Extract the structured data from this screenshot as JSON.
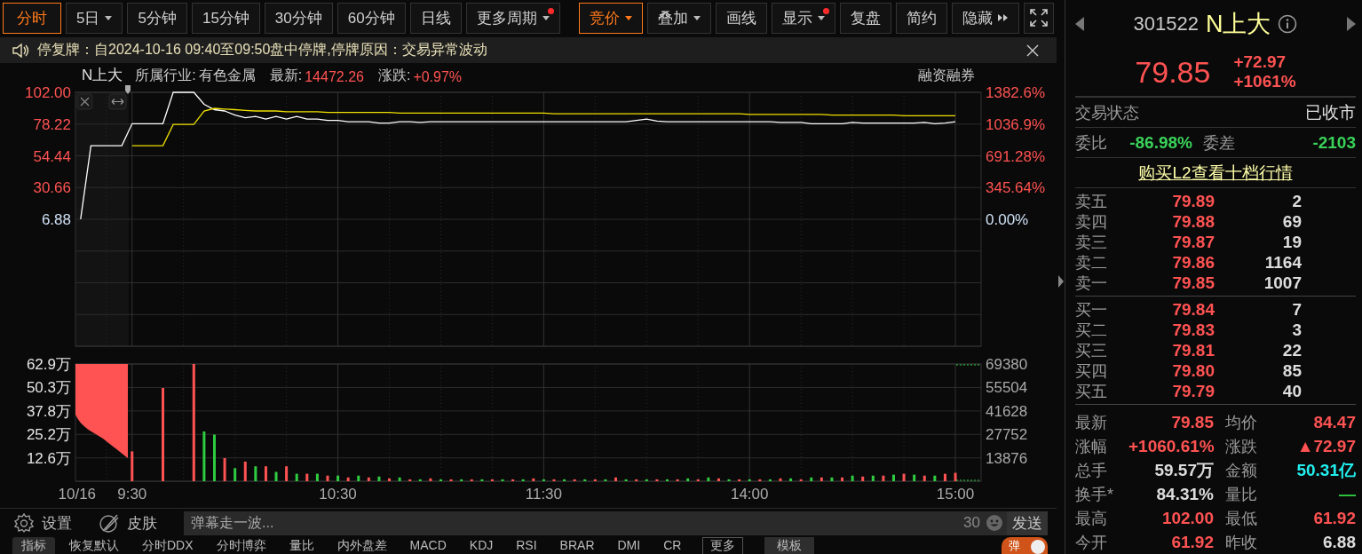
{
  "toolbar": {
    "periods": [
      {
        "label": "分时",
        "selected": true,
        "dropdown": false,
        "dot": false
      },
      {
        "label": "5日",
        "selected": false,
        "dropdown": true,
        "dot": false
      },
      {
        "label": "5分钟",
        "selected": false,
        "dropdown": false,
        "dot": false
      },
      {
        "label": "15分钟",
        "selected": false,
        "dropdown": false,
        "dot": false
      },
      {
        "label": "30分钟",
        "selected": false,
        "dropdown": false,
        "dot": false
      },
      {
        "label": "60分钟",
        "selected": false,
        "dropdown": false,
        "dot": false
      },
      {
        "label": "日线",
        "selected": false,
        "dropdown": false,
        "dot": false
      },
      {
        "label": "更多周期",
        "selected": false,
        "dropdown": true,
        "dot": true
      }
    ],
    "tools": [
      {
        "label": "竞价",
        "on": true,
        "dropdown": true,
        "dot": false
      },
      {
        "label": "叠加",
        "on": false,
        "dropdown": true,
        "dot": false
      },
      {
        "label": "画线",
        "on": false,
        "dropdown": false,
        "dot": false
      },
      {
        "label": "显示",
        "on": false,
        "dropdown": true,
        "dot": true
      },
      {
        "label": "复盘",
        "on": false,
        "dropdown": false,
        "dot": false
      },
      {
        "label": "简约",
        "on": false,
        "dropdown": false,
        "dot": false
      }
    ],
    "hide_button": "隐藏"
  },
  "notice": "停复牌：自2024-10-16 09:40至09:50盘中停牌,停牌原因：交易异常波动",
  "chart_header": {
    "name": "N上大",
    "items": [
      {
        "label": "所属行业:",
        "value": "有色金属",
        "color": "#c8c8c8"
      },
      {
        "label": "最新:",
        "value": "14472.26",
        "color": "#ff5252"
      },
      {
        "label": "涨跌:",
        "value": "+0.97%",
        "color": "#ff5252"
      }
    ],
    "right_label": "融资融券"
  },
  "price_chart": {
    "right_axis": [
      "1382.6%",
      "1036.9%",
      "691.28%",
      "345.64%",
      "0.00%"
    ],
    "chart_data": {
      "type": "line",
      "grid": true,
      "ylim": [
        -88.24,
        102
      ],
      "yticks": [
        {
          "value": 102,
          "label": "102.00"
        },
        {
          "value": 78.22,
          "label": "78.22"
        },
        {
          "value": 54.44,
          "label": "54.44"
        },
        {
          "value": 30.66,
          "label": "30.66"
        },
        {
          "value": 6.88,
          "label": "6.88"
        }
      ],
      "series": [
        {
          "color": "#ffffff",
          "values": [
            7,
            62,
            62,
            62,
            62,
            78.5,
            78.5,
            78.5,
            78.5,
            102,
            102,
            102,
            93,
            89,
            88,
            85,
            83,
            84,
            82,
            84,
            82,
            84,
            82,
            82,
            81,
            81,
            80,
            80,
            80,
            79,
            79,
            80,
            80,
            79.5,
            80,
            80,
            80,
            80,
            80,
            80,
            80,
            80,
            80,
            80,
            80,
            80,
            80,
            80,
            80,
            80,
            80,
            80,
            80,
            80,
            81,
            82,
            80.5,
            80,
            80,
            80,
            80,
            80,
            80,
            80,
            80,
            80,
            80,
            80,
            79.5,
            79.5,
            79.5,
            78.5,
            78.5,
            78.5,
            78.5,
            79.5,
            79,
            79,
            79,
            79,
            79,
            79,
            79.5,
            78.5,
            79,
            80,
            null,
            null
          ]
        },
        {
          "color": "#f0e000",
          "values": [
            null,
            null,
            null,
            null,
            null,
            62,
            62,
            62,
            62,
            78,
            78,
            78,
            88,
            90,
            89.5,
            89,
            88.5,
            88,
            88,
            88,
            87.5,
            87.5,
            87.5,
            87.5,
            87,
            87,
            87,
            87,
            87,
            87,
            87,
            86.5,
            86.5,
            86.5,
            86.5,
            86.5,
            86.5,
            86.5,
            86.5,
            86.5,
            86.5,
            86.5,
            86.5,
            86.5,
            86.5,
            86.5,
            86,
            86,
            86,
            86,
            86,
            86,
            86,
            86,
            86,
            86,
            86,
            86,
            86,
            86,
            86,
            86,
            86,
            86,
            86,
            85.5,
            85.5,
            85.5,
            85.5,
            85.5,
            85.5,
            85.5,
            85.5,
            85,
            85,
            85,
            85,
            85,
            85,
            85,
            84.5,
            84.5,
            84.5,
            84.5,
            84.5,
            84.5,
            null,
            null
          ]
        }
      ]
    }
  },
  "volume_chart": {
    "right_axis": [
      "69380",
      "55504",
      "41628",
      "27752",
      "13876"
    ],
    "chart_data": {
      "type": "bar",
      "stacked": true,
      "grid": true,
      "ylim": [
        0,
        62.9
      ],
      "yticks": [
        {
          "value": 62.9,
          "label": "62.9万"
        },
        {
          "value": 50.3,
          "label": "50.3万"
        },
        {
          "value": 37.8,
          "label": "37.8万"
        },
        {
          "value": 25.2,
          "label": "25.2万"
        },
        {
          "value": 12.6,
          "label": "12.6万"
        }
      ],
      "categories": [
        "10/16",
        null,
        null,
        null,
        null,
        "9:30",
        null,
        null,
        null,
        null,
        null,
        null,
        null,
        null,
        null,
        null,
        null,
        null,
        null,
        null,
        null,
        null,
        null,
        null,
        null,
        "10:30",
        null,
        null,
        null,
        null,
        null,
        null,
        null,
        null,
        null,
        null,
        null,
        null,
        null,
        null,
        null,
        null,
        null,
        null,
        null,
        "11:30",
        null,
        null,
        null,
        null,
        null,
        null,
        null,
        null,
        null,
        null,
        null,
        null,
        null,
        null,
        null,
        null,
        null,
        null,
        null,
        "14:00",
        null,
        null,
        null,
        null,
        null,
        null,
        null,
        null,
        null,
        null,
        null,
        null,
        null,
        null,
        null,
        null,
        null,
        null,
        null,
        "15:00",
        null,
        null
      ],
      "series": [
        {
          "color": "#ff5252",
          "values": [
            null,
            null,
            null,
            null,
            null,
            16,
            null,
            null,
            50,
            null,
            null,
            62.9,
            null,
            null,
            12.4,
            null,
            10.5,
            null,
            8,
            null,
            8,
            null,
            4,
            null,
            3,
            null,
            2,
            null,
            2,
            null,
            1.5,
            null,
            1,
            null,
            1.5,
            null,
            1,
            null,
            1,
            null,
            1,
            null,
            1,
            null,
            1.5,
            null,
            1,
            null,
            1,
            null,
            1,
            null,
            2,
            null,
            1,
            null,
            1,
            null,
            1,
            null,
            1,
            null,
            1.5,
            null,
            1,
            null,
            1,
            null,
            1.5,
            null,
            1,
            null,
            2,
            null,
            2,
            null,
            2.5,
            null,
            3,
            null,
            4,
            null,
            3,
            null,
            4,
            4.5,
            null,
            null
          ]
        },
        {
          "color": "#2ecc40",
          "values": [
            null,
            null,
            null,
            null,
            null,
            null,
            null,
            null,
            null,
            null,
            null,
            null,
            26.7,
            25,
            null,
            7,
            null,
            8,
            null,
            5,
            null,
            4,
            null,
            4,
            null,
            3,
            null,
            3,
            null,
            2.5,
            null,
            2,
            null,
            1,
            null,
            1,
            null,
            1,
            null,
            1,
            null,
            1,
            null,
            1,
            null,
            1,
            null,
            1,
            null,
            1,
            null,
            1,
            null,
            1,
            null,
            1,
            null,
            1,
            null,
            1.5,
            null,
            2,
            null,
            1,
            null,
            1,
            null,
            1,
            null,
            1.5,
            null,
            2,
            null,
            2,
            null,
            3,
            null,
            3,
            null,
            3.5,
            null,
            3.5,
            null,
            3,
            null,
            null,
            null,
            null
          ]
        }
      ]
    }
  },
  "bottom_bar": {
    "settings": "设置",
    "skin": "皮肤",
    "danmaku_placeholder": "弹幕走一波...",
    "count": "30",
    "send": "发送"
  },
  "indicator_tabs": [
    {
      "label": "指标",
      "selected": true
    },
    {
      "label": "恢复默认",
      "selected": false
    },
    {
      "label": "分时DDX",
      "selected": false
    },
    {
      "label": "分时博弈",
      "selected": false
    },
    {
      "label": "量比",
      "selected": false
    },
    {
      "label": "内外盘差",
      "selected": false
    },
    {
      "label": "MACD",
      "selected": false
    },
    {
      "label": "KDJ",
      "selected": false
    },
    {
      "label": "RSI",
      "selected": false
    },
    {
      "label": "BRAR",
      "selected": false
    },
    {
      "label": "DMI",
      "selected": false
    },
    {
      "label": "CR",
      "selected": false
    }
  ],
  "more_button": "更多",
  "template_button": "模板",
  "danmaku_toggle": {
    "label": "弹",
    "on": true
  },
  "quote": {
    "code": "301522",
    "name": "N上大",
    "price": "79.85",
    "change": "+72.97",
    "change_pct": "+1061%"
  },
  "status": {
    "label": "交易状态",
    "value": "已收市"
  },
  "order_ratio": [
    {
      "label": "委比",
      "value": "-86.98%"
    },
    {
      "label": "委差",
      "value": "-2103"
    }
  ],
  "l2_link": "购买L2查看十档行情",
  "asks": [
    {
      "label": "卖五",
      "price": "79.89",
      "volume": "2"
    },
    {
      "label": "卖四",
      "price": "79.88",
      "volume": "69"
    },
    {
      "label": "卖三",
      "price": "79.87",
      "volume": "19"
    },
    {
      "label": "卖二",
      "price": "79.86",
      "volume": "1164"
    },
    {
      "label": "卖一",
      "price": "79.85",
      "volume": "1007"
    }
  ],
  "bids": [
    {
      "label": "买一",
      "price": "79.84",
      "volume": "7"
    },
    {
      "label": "买二",
      "price": "79.83",
      "volume": "3"
    },
    {
      "label": "买三",
      "price": "79.81",
      "volume": "22"
    },
    {
      "label": "买四",
      "price": "79.80",
      "volume": "85"
    },
    {
      "label": "买五",
      "price": "79.79",
      "volume": "40"
    }
  ],
  "stats": [
    {
      "label": "最新",
      "value": "79.85",
      "color": "#ff5252"
    },
    {
      "label": "均价",
      "value": "84.47",
      "color": "#ff5252"
    },
    {
      "label": "涨幅",
      "value": "+1060.61%",
      "color": "#ff5252"
    },
    {
      "label": "涨跌",
      "value": "▲72.97",
      "color": "#ff5252"
    },
    {
      "label": "总手",
      "value": "59.57万",
      "color": "#dddddd"
    },
    {
      "label": "金额",
      "value": "50.31亿",
      "color": "#22eeee"
    },
    {
      "label": "换手*",
      "value": "84.31%",
      "color": "#dddddd"
    },
    {
      "label": "量比",
      "value": "—",
      "color": "#2ecc40"
    },
    {
      "label": "最高",
      "value": "102.00",
      "color": "#ff5252"
    },
    {
      "label": "最低",
      "value": "61.92",
      "color": "#ff5252"
    },
    {
      "label": "今开",
      "value": "61.92",
      "color": "#ff5252"
    },
    {
      "label": "昨收",
      "value": "6.88",
      "color": "#dddddd"
    }
  ]
}
